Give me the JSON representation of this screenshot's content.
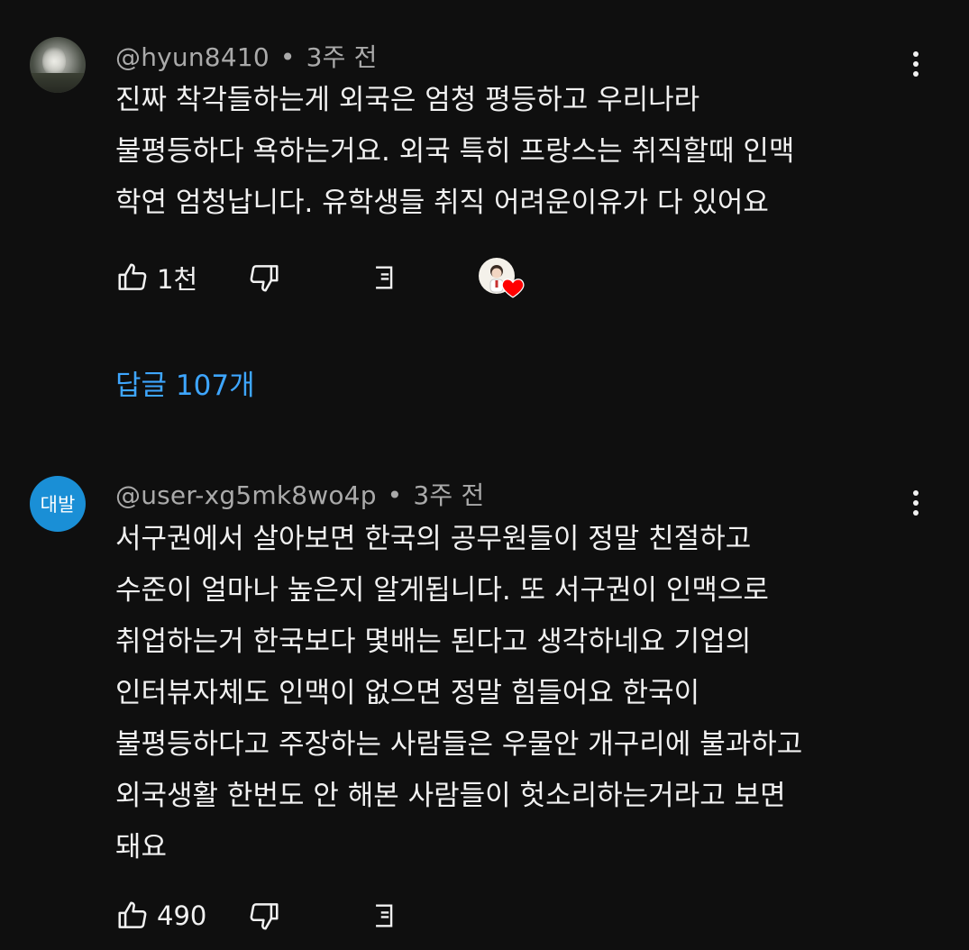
{
  "comments": [
    {
      "handle": "@hyun8410",
      "separator": "•",
      "time": "3주 전",
      "avatar_type": "photo",
      "lines": [
        "진짜 착각들하는게 외국은 엄청 평등하고 우리나라",
        "불평등하다 욕하는거요. 외국 특히 프랑스는 취직할때 인맥",
        "학연 엄청납니다. 유학생들 취직 어려운이유가 다 있어요"
      ],
      "likes": "1천",
      "creator_hearted": true,
      "replies_label": "답글 107개"
    },
    {
      "handle": "@user-xg5mk8wo4p",
      "separator": "•",
      "time": "3주 전",
      "avatar_type": "initial",
      "avatar_text": "대발",
      "avatar_color": "#1a8fd6",
      "lines": [
        "서구권에서 살아보면 한국의 공무원들이 정말 친절하고",
        "수준이 얼마나 높은지 알게됩니다. 또 서구권이 인맥으로",
        "취업하는거 한국보다 몇배는 된다고 생각하네요 기업의",
        "인터뷰자체도 인맥이 없으면 정말 힘들어요  한국이",
        "불평등하다고 주장하는 사람들은 우물안 개구리에 불과하고",
        "외국생활 한번도 안 해본 사람들이 헛소리하는거라고 보면",
        "돼요"
      ],
      "likes": "490",
      "creator_hearted": false
    }
  ],
  "icons": {
    "like": "thumb-up-icon",
    "dislike": "thumb-down-icon",
    "reply": "reply-icon",
    "more": "more-vert-icon",
    "heart": "creator-heart-icon"
  },
  "colors": {
    "background": "#0f0f0f",
    "text": "#f1f1f1",
    "meta": "#aaaaaa",
    "link": "#3ea6ff",
    "heart": "#ff0000"
  }
}
